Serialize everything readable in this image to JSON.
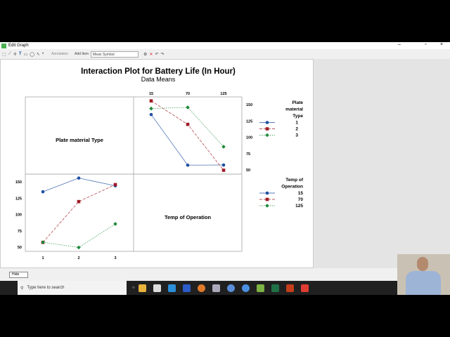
{
  "window": {
    "title": "Edit Graph",
    "controls": [
      "–",
      "▫",
      "×"
    ]
  },
  "toolbar": {
    "annotation": "Annotation",
    "add_item": "Add Item",
    "selected": "Mean Symbol"
  },
  "chart_data": {
    "type": "line",
    "title": "Interaction Plot for Battery Life (In Hour)",
    "subtitle": "Data Means",
    "panel_labels": [
      "Plate material Type",
      "Temp of Operation"
    ],
    "ylim": [
      45,
      160
    ],
    "yticks": [
      50,
      75,
      100,
      125,
      150
    ],
    "panels": [
      {
        "name": "by-temp",
        "factor": "Plate material Type",
        "x": [
          15,
          70,
          125
        ],
        "series": [
          {
            "name": "1",
            "values": [
              134.75,
              57.25,
              57.5
            ]
          },
          {
            "name": "2",
            "values": [
              155.75,
              119.75,
              49.5
            ]
          },
          {
            "name": "3",
            "values": [
              144,
              145.75,
              85.5
            ]
          }
        ]
      },
      {
        "name": "by-material",
        "factor": "Temp of Operation",
        "x": [
          1,
          2,
          3
        ],
        "series": [
          {
            "name": "15",
            "values": [
              134.75,
              155.75,
              144
            ]
          },
          {
            "name": "70",
            "values": [
              57.25,
              119.75,
              145.75
            ]
          },
          {
            "name": "125",
            "values": [
              57.5,
              49.5,
              85.5
            ]
          }
        ]
      }
    ],
    "legends": [
      {
        "title": "Plate material Type",
        "entries": [
          "1",
          "2",
          "3"
        ]
      },
      {
        "title": "Temp of Operation",
        "entries": [
          "15",
          "70",
          "125"
        ]
      }
    ],
    "colors": [
      "#1f4fa3",
      "#a01c25",
      "#1e8a3a"
    ]
  },
  "statusbar": {
    "button": "Hide"
  },
  "taskbar": {
    "search": "Type here to search"
  }
}
